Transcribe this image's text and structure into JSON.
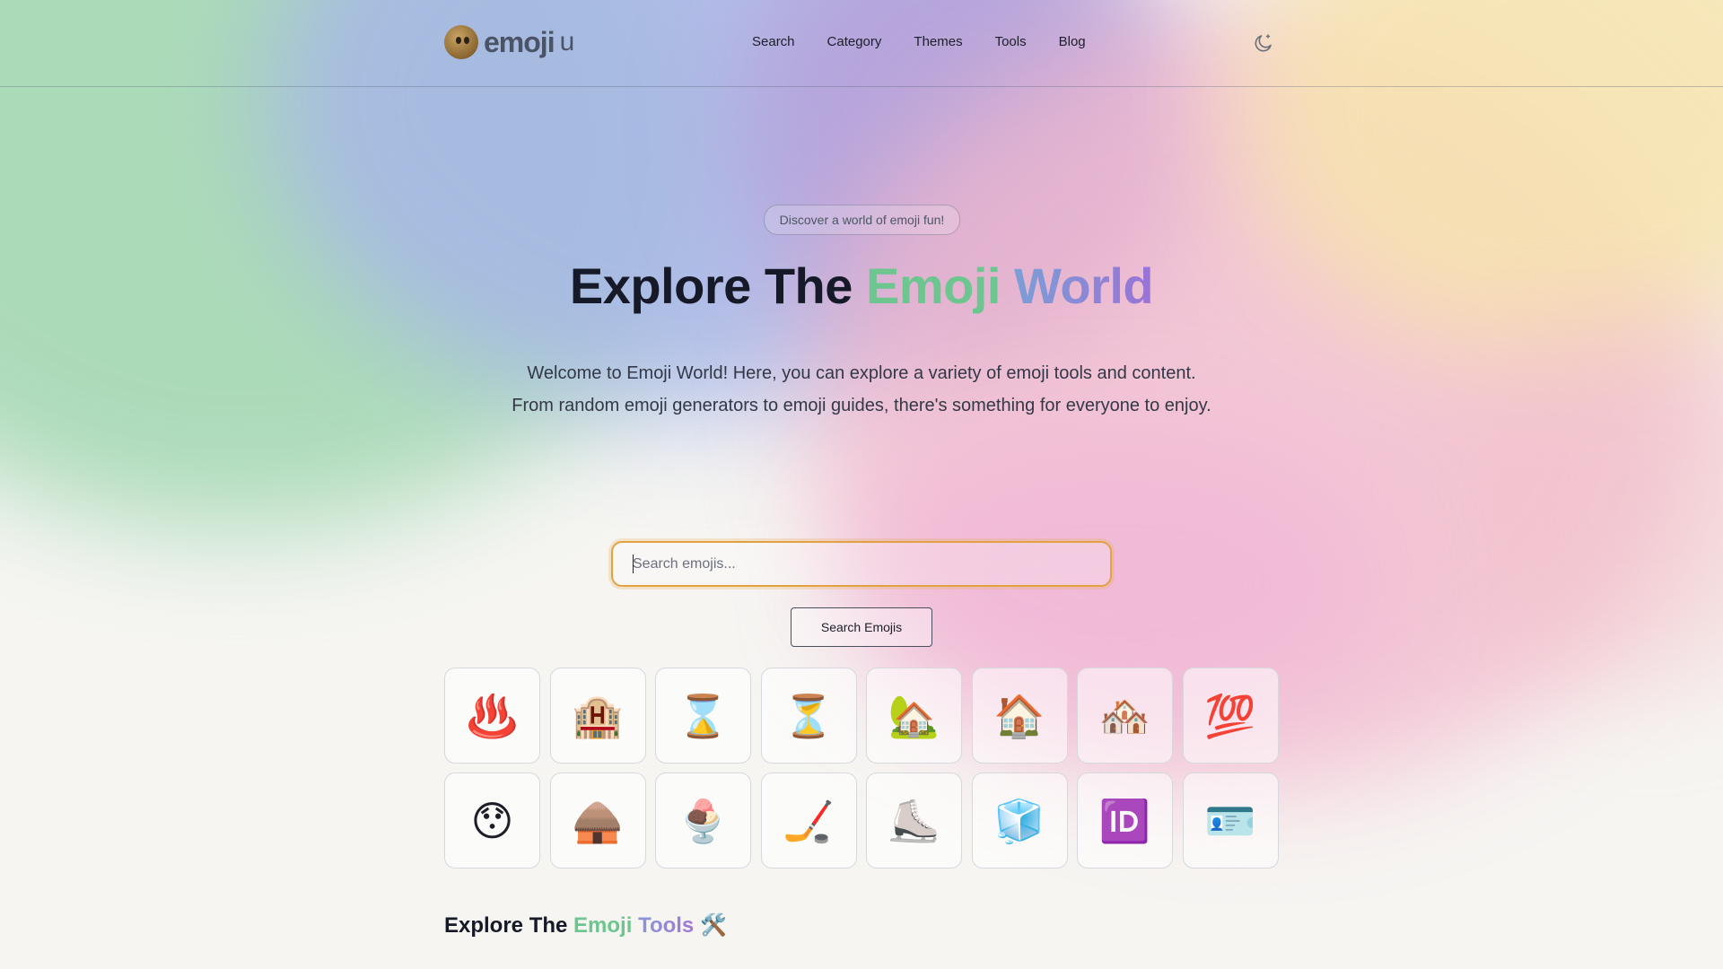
{
  "header": {
    "logo_text": "emoji",
    "logo_suffix": "u",
    "nav": [
      {
        "label": "Search"
      },
      {
        "label": "Category"
      },
      {
        "label": "Themes"
      },
      {
        "label": "Tools"
      },
      {
        "label": "Blog"
      }
    ],
    "theme_toggle_icon": "moon-icon"
  },
  "hero": {
    "badge": "Discover a world of emoji fun!",
    "title_prefix": "Explore The ",
    "title_highlight_1": "Emoji",
    "title_highlight_2": "World",
    "description_line_1": "Welcome to Emoji World! Here, you can explore a variety of emoji tools and content.",
    "description_line_2": "From random emoji generators to emoji guides, there's something for everyone to enjoy."
  },
  "search": {
    "placeholder": "Search emojis...",
    "value": "",
    "button_label": "Search Emojis"
  },
  "emojis": [
    {
      "char": "♨️",
      "name": "hot-springs"
    },
    {
      "char": "🏨",
      "name": "hotel"
    },
    {
      "char": "⌛",
      "name": "hourglass-done"
    },
    {
      "char": "⏳",
      "name": "hourglass-not-done"
    },
    {
      "char": "🏡",
      "name": "house-with-garden"
    },
    {
      "char": "🏠",
      "name": "house"
    },
    {
      "char": "🏘️",
      "name": "houses"
    },
    {
      "char": "💯",
      "name": "hundred-points"
    },
    {
      "char": "😯",
      "name": "hushed-face"
    },
    {
      "char": "🛖",
      "name": "hut"
    },
    {
      "char": "🍨",
      "name": "ice-cream"
    },
    {
      "char": "🏒",
      "name": "ice-hockey"
    },
    {
      "char": "⛸️",
      "name": "ice-skate"
    },
    {
      "char": "🧊",
      "name": "ice"
    },
    {
      "char": "🆔",
      "name": "id-button"
    },
    {
      "char": "🪪",
      "name": "identification-card"
    }
  ],
  "tools": {
    "title_prefix": "Explore The ",
    "title_highlight_1": "Emoji",
    "title_highlight_2": "Tools",
    "title_emoji": "🛠️"
  },
  "colors": {
    "accent_green": "#6dc58f",
    "accent_purple": "#9a72d6",
    "search_focus": "#e2a241"
  }
}
